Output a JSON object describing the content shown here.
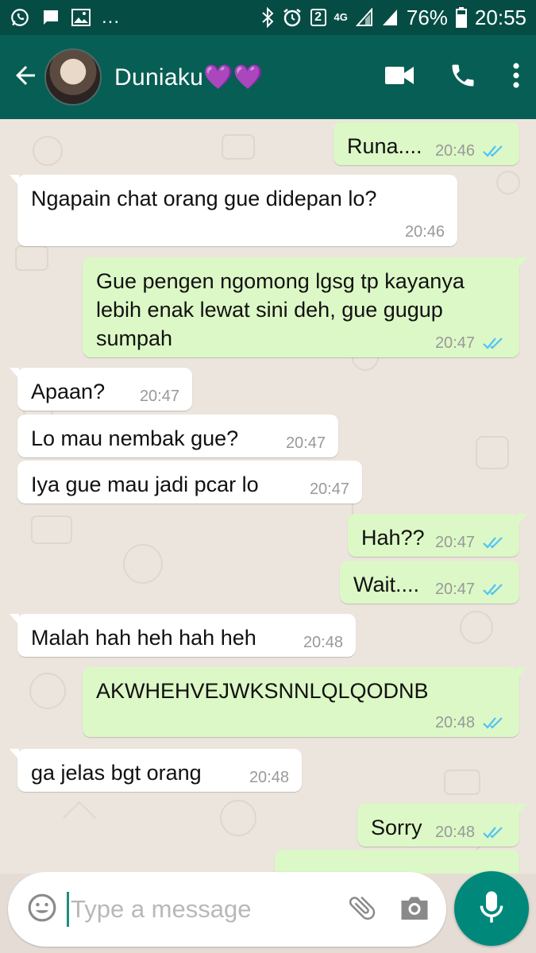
{
  "status_bar": {
    "battery": "76%",
    "time": "20:55",
    "sim_badge": "2",
    "network": "4G",
    "more_dots": "..."
  },
  "header": {
    "contact_name": "Duniaku",
    "contact_emoji": "💜💜"
  },
  "messages": [
    {
      "dir": "out",
      "text": "Runa....",
      "time": "20:46",
      "ticks": "read"
    },
    {
      "dir": "in",
      "text": "Ngapain chat orang gue didepan lo?",
      "time": "20:46"
    },
    {
      "dir": "out",
      "text": "Gue pengen ngomong lgsg tp kayanya lebih enak lewat sini deh, gue gugup sumpah",
      "time": "20:47",
      "ticks": "read"
    },
    {
      "dir": "in",
      "text": "Apaan?",
      "time": "20:47"
    },
    {
      "dir": "in",
      "text": "Lo mau nembak gue?",
      "time": "20:47"
    },
    {
      "dir": "in",
      "text": "Iya gue mau jadi pcar lo",
      "time": "20:47"
    },
    {
      "dir": "out",
      "text": "Hah??",
      "time": "20:47",
      "ticks": "read"
    },
    {
      "dir": "out",
      "text": "Wait....",
      "time": "20:47",
      "ticks": "read"
    },
    {
      "dir": "in",
      "text": "Malah hah heh hah heh",
      "time": "20:48"
    },
    {
      "dir": "out",
      "text": "AKWHEHVEJWKSNNLQLQODNB",
      "time": "20:48",
      "ticks": "read"
    },
    {
      "dir": "in",
      "text": "ga jelas bgt orang",
      "time": "20:48"
    },
    {
      "dir": "out",
      "text": "Sorry",
      "time": "20:48",
      "ticks": "read"
    }
  ],
  "composer": {
    "placeholder": "Type a message"
  },
  "icons": {
    "back": "arrow-back-icon",
    "video": "video-call-icon",
    "call": "phone-icon",
    "menu": "more-vert-icon",
    "emoji": "emoji-icon",
    "attach": "paperclip-icon",
    "camera": "camera-icon",
    "mic": "mic-icon"
  },
  "colors": {
    "header": "#075e54",
    "status_bar": "#054d44",
    "outgoing_bubble": "#dcf8c6",
    "incoming_bubble": "#ffffff",
    "read_ticks": "#4fc3f7",
    "mic_button": "#00897b"
  }
}
